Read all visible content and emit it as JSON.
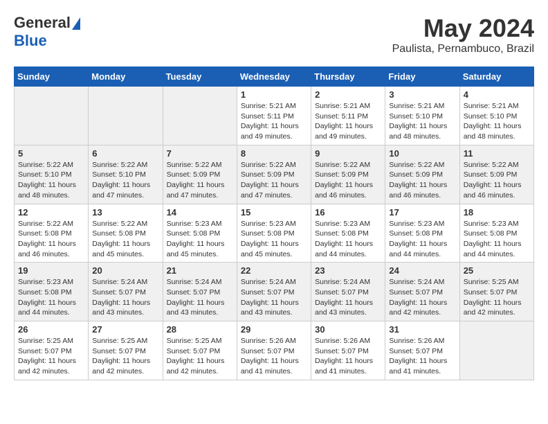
{
  "header": {
    "logo_general": "General",
    "logo_blue": "Blue",
    "month_title": "May 2024",
    "location": "Paulista, Pernambuco, Brazil"
  },
  "days_of_week": [
    "Sunday",
    "Monday",
    "Tuesday",
    "Wednesday",
    "Thursday",
    "Friday",
    "Saturday"
  ],
  "weeks": [
    {
      "days": [
        {
          "num": "",
          "info": ""
        },
        {
          "num": "",
          "info": ""
        },
        {
          "num": "",
          "info": ""
        },
        {
          "num": "1",
          "info": "Sunrise: 5:21 AM\nSunset: 5:11 PM\nDaylight: 11 hours and 49 minutes."
        },
        {
          "num": "2",
          "info": "Sunrise: 5:21 AM\nSunset: 5:11 PM\nDaylight: 11 hours and 49 minutes."
        },
        {
          "num": "3",
          "info": "Sunrise: 5:21 AM\nSunset: 5:10 PM\nDaylight: 11 hours and 48 minutes."
        },
        {
          "num": "4",
          "info": "Sunrise: 5:21 AM\nSunset: 5:10 PM\nDaylight: 11 hours and 48 minutes."
        }
      ]
    },
    {
      "days": [
        {
          "num": "5",
          "info": "Sunrise: 5:22 AM\nSunset: 5:10 PM\nDaylight: 11 hours and 48 minutes."
        },
        {
          "num": "6",
          "info": "Sunrise: 5:22 AM\nSunset: 5:10 PM\nDaylight: 11 hours and 47 minutes."
        },
        {
          "num": "7",
          "info": "Sunrise: 5:22 AM\nSunset: 5:09 PM\nDaylight: 11 hours and 47 minutes."
        },
        {
          "num": "8",
          "info": "Sunrise: 5:22 AM\nSunset: 5:09 PM\nDaylight: 11 hours and 47 minutes."
        },
        {
          "num": "9",
          "info": "Sunrise: 5:22 AM\nSunset: 5:09 PM\nDaylight: 11 hours and 46 minutes."
        },
        {
          "num": "10",
          "info": "Sunrise: 5:22 AM\nSunset: 5:09 PM\nDaylight: 11 hours and 46 minutes."
        },
        {
          "num": "11",
          "info": "Sunrise: 5:22 AM\nSunset: 5:09 PM\nDaylight: 11 hours and 46 minutes."
        }
      ]
    },
    {
      "days": [
        {
          "num": "12",
          "info": "Sunrise: 5:22 AM\nSunset: 5:08 PM\nDaylight: 11 hours and 46 minutes."
        },
        {
          "num": "13",
          "info": "Sunrise: 5:22 AM\nSunset: 5:08 PM\nDaylight: 11 hours and 45 minutes."
        },
        {
          "num": "14",
          "info": "Sunrise: 5:23 AM\nSunset: 5:08 PM\nDaylight: 11 hours and 45 minutes."
        },
        {
          "num": "15",
          "info": "Sunrise: 5:23 AM\nSunset: 5:08 PM\nDaylight: 11 hours and 45 minutes."
        },
        {
          "num": "16",
          "info": "Sunrise: 5:23 AM\nSunset: 5:08 PM\nDaylight: 11 hours and 44 minutes."
        },
        {
          "num": "17",
          "info": "Sunrise: 5:23 AM\nSunset: 5:08 PM\nDaylight: 11 hours and 44 minutes."
        },
        {
          "num": "18",
          "info": "Sunrise: 5:23 AM\nSunset: 5:08 PM\nDaylight: 11 hours and 44 minutes."
        }
      ]
    },
    {
      "days": [
        {
          "num": "19",
          "info": "Sunrise: 5:23 AM\nSunset: 5:08 PM\nDaylight: 11 hours and 44 minutes."
        },
        {
          "num": "20",
          "info": "Sunrise: 5:24 AM\nSunset: 5:07 PM\nDaylight: 11 hours and 43 minutes."
        },
        {
          "num": "21",
          "info": "Sunrise: 5:24 AM\nSunset: 5:07 PM\nDaylight: 11 hours and 43 minutes."
        },
        {
          "num": "22",
          "info": "Sunrise: 5:24 AM\nSunset: 5:07 PM\nDaylight: 11 hours and 43 minutes."
        },
        {
          "num": "23",
          "info": "Sunrise: 5:24 AM\nSunset: 5:07 PM\nDaylight: 11 hours and 43 minutes."
        },
        {
          "num": "24",
          "info": "Sunrise: 5:24 AM\nSunset: 5:07 PM\nDaylight: 11 hours and 42 minutes."
        },
        {
          "num": "25",
          "info": "Sunrise: 5:25 AM\nSunset: 5:07 PM\nDaylight: 11 hours and 42 minutes."
        }
      ]
    },
    {
      "days": [
        {
          "num": "26",
          "info": "Sunrise: 5:25 AM\nSunset: 5:07 PM\nDaylight: 11 hours and 42 minutes."
        },
        {
          "num": "27",
          "info": "Sunrise: 5:25 AM\nSunset: 5:07 PM\nDaylight: 11 hours and 42 minutes."
        },
        {
          "num": "28",
          "info": "Sunrise: 5:25 AM\nSunset: 5:07 PM\nDaylight: 11 hours and 42 minutes."
        },
        {
          "num": "29",
          "info": "Sunrise: 5:26 AM\nSunset: 5:07 PM\nDaylight: 11 hours and 41 minutes."
        },
        {
          "num": "30",
          "info": "Sunrise: 5:26 AM\nSunset: 5:07 PM\nDaylight: 11 hours and 41 minutes."
        },
        {
          "num": "31",
          "info": "Sunrise: 5:26 AM\nSunset: 5:07 PM\nDaylight: 11 hours and 41 minutes."
        },
        {
          "num": "",
          "info": ""
        }
      ]
    }
  ]
}
